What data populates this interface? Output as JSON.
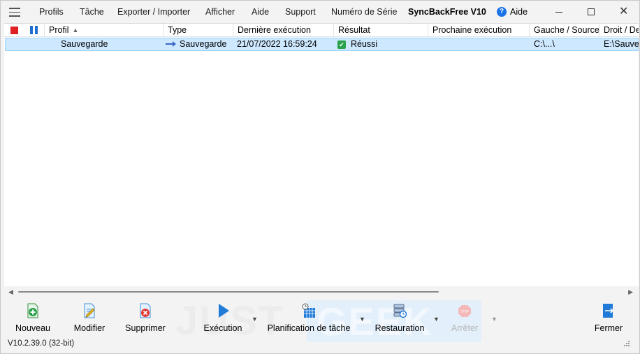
{
  "menu": {
    "items": [
      "Profils",
      "Tâche",
      "Exporter / Importer",
      "Afficher",
      "Aide",
      "Support",
      "Numéro de Série"
    ],
    "app_title": "SyncBackFree V10",
    "help_label": "Aide"
  },
  "list": {
    "columns": [
      "Profil",
      "Type",
      "Dernière exécution",
      "Résultat",
      "Prochaine exécution",
      "Gauche / Source",
      "Droit / De"
    ],
    "rows": [
      {
        "profile": "Sauvegarde",
        "type": "Sauvegarde",
        "last_run": "21/07/2022 16:59:24",
        "result": "Réussi",
        "next_run": "",
        "source": "C:\\...\\",
        "destination": "E:\\Sauve"
      }
    ]
  },
  "toolbar": {
    "new_label": "Nouveau",
    "edit_label": "Modifier",
    "delete_label": "Supprimer",
    "run_label": "Exécution",
    "schedule_label": "Planification de tâche",
    "restore_label": "Restauration",
    "stop_label": "Arrêter",
    "close_label": "Fermer"
  },
  "watermark": {
    "part1": "JUST",
    "part2": "GEEK"
  },
  "status": {
    "version": "V10.2.39.0 (32-bit)"
  },
  "colors": {
    "selection": "#cde8ff",
    "stop_red": "#e02020",
    "pause_blue": "#1f6fd0",
    "success_green": "#2aa24a"
  }
}
